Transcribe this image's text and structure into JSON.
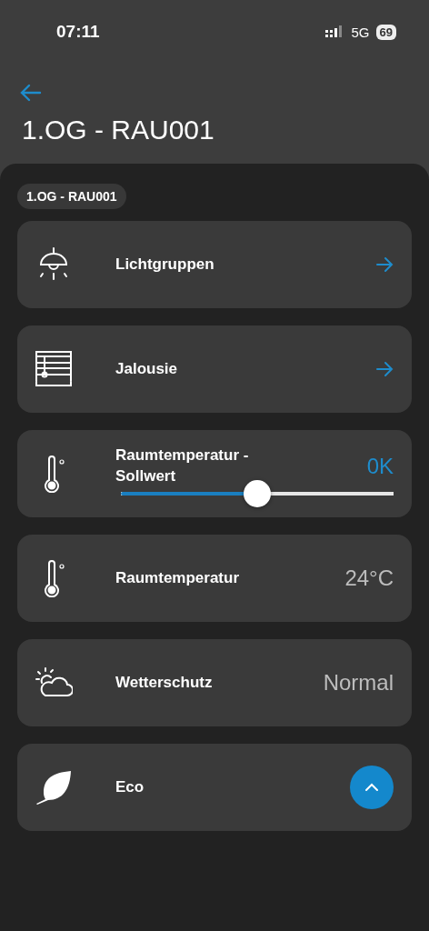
{
  "status_bar": {
    "time": "07:11",
    "network": "5G",
    "battery": "69"
  },
  "header": {
    "title": "1.OG - RAU001"
  },
  "chip": "1.OG - RAU001",
  "items": [
    {
      "kind": "nav",
      "label": "Lichtgruppen"
    },
    {
      "kind": "nav",
      "label": "Jalousie"
    },
    {
      "kind": "slider",
      "label": "Raumtemperatur - Sollwert",
      "reading": "0K",
      "level": 0.5
    },
    {
      "kind": "value",
      "label": "Raumtemperatur",
      "value": "24°C"
    },
    {
      "kind": "value",
      "label": "Wetterschutz",
      "value": "Normal"
    },
    {
      "kind": "button",
      "label": "Eco"
    }
  ]
}
